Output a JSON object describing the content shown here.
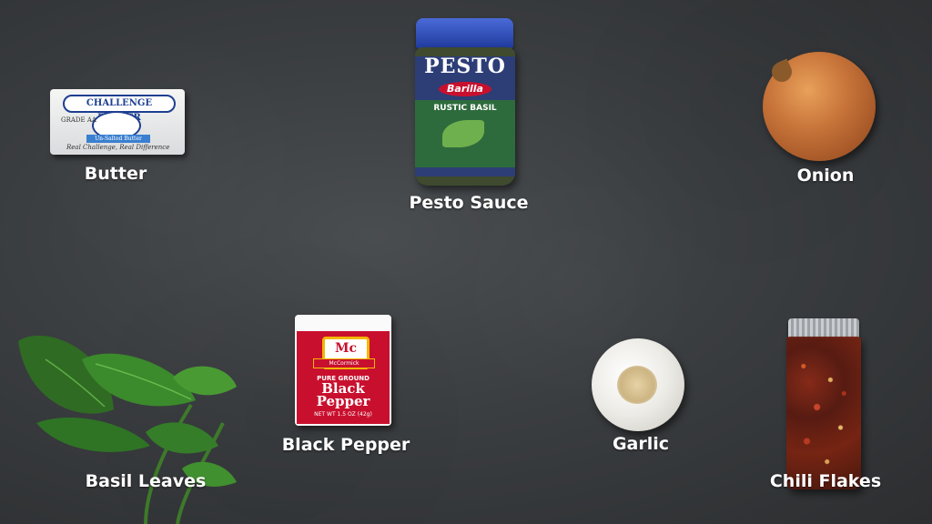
{
  "labels": {
    "butter": "Butter",
    "pesto": "Pesto Sauce",
    "onion": "Onion",
    "basil": "Basil Leaves",
    "pepper": "Black Pepper",
    "garlic": "Garlic",
    "chili": "Chili Flakes"
  },
  "butter_pack": {
    "brand": "CHALLENGE BUTTER",
    "grade": "GRADE AA",
    "band": "Un-Salted Butter",
    "slogan": "Real Challenge, Real Difference"
  },
  "pesto_jar": {
    "name": "PESTO",
    "brand": "Barilla",
    "variety": "RUSTIC BASIL",
    "lid_color": "#2b47b0"
  },
  "pepper_tin": {
    "brand": "McCormick",
    "logo": "Mc",
    "line1": "PURE GROUND",
    "line2": "Black Pepper",
    "net": "NET WT 1.5 OZ (42g)"
  },
  "colors": {
    "background": "#3b3e41",
    "label_text": "#ffffff"
  }
}
